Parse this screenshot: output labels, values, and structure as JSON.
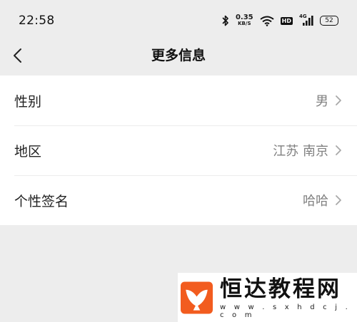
{
  "status_bar": {
    "time": "22:58",
    "net_speed_value": "0.35",
    "net_speed_unit": "KB/S",
    "hd_badge": "HD",
    "network_type": "4G",
    "battery": "52"
  },
  "header": {
    "title": "更多信息"
  },
  "rows": [
    {
      "label": "性别",
      "value": "男"
    },
    {
      "label": "地区",
      "value": "江苏 南京"
    },
    {
      "label": "个性签名",
      "value": "哈哈"
    }
  ],
  "watermark": {
    "title": "恒达教程网",
    "url": "w w w . s x h d c j . c o m"
  },
  "colors": {
    "background": "#ededed",
    "value_text": "#808080",
    "logo_orange": "#f25c1f"
  }
}
